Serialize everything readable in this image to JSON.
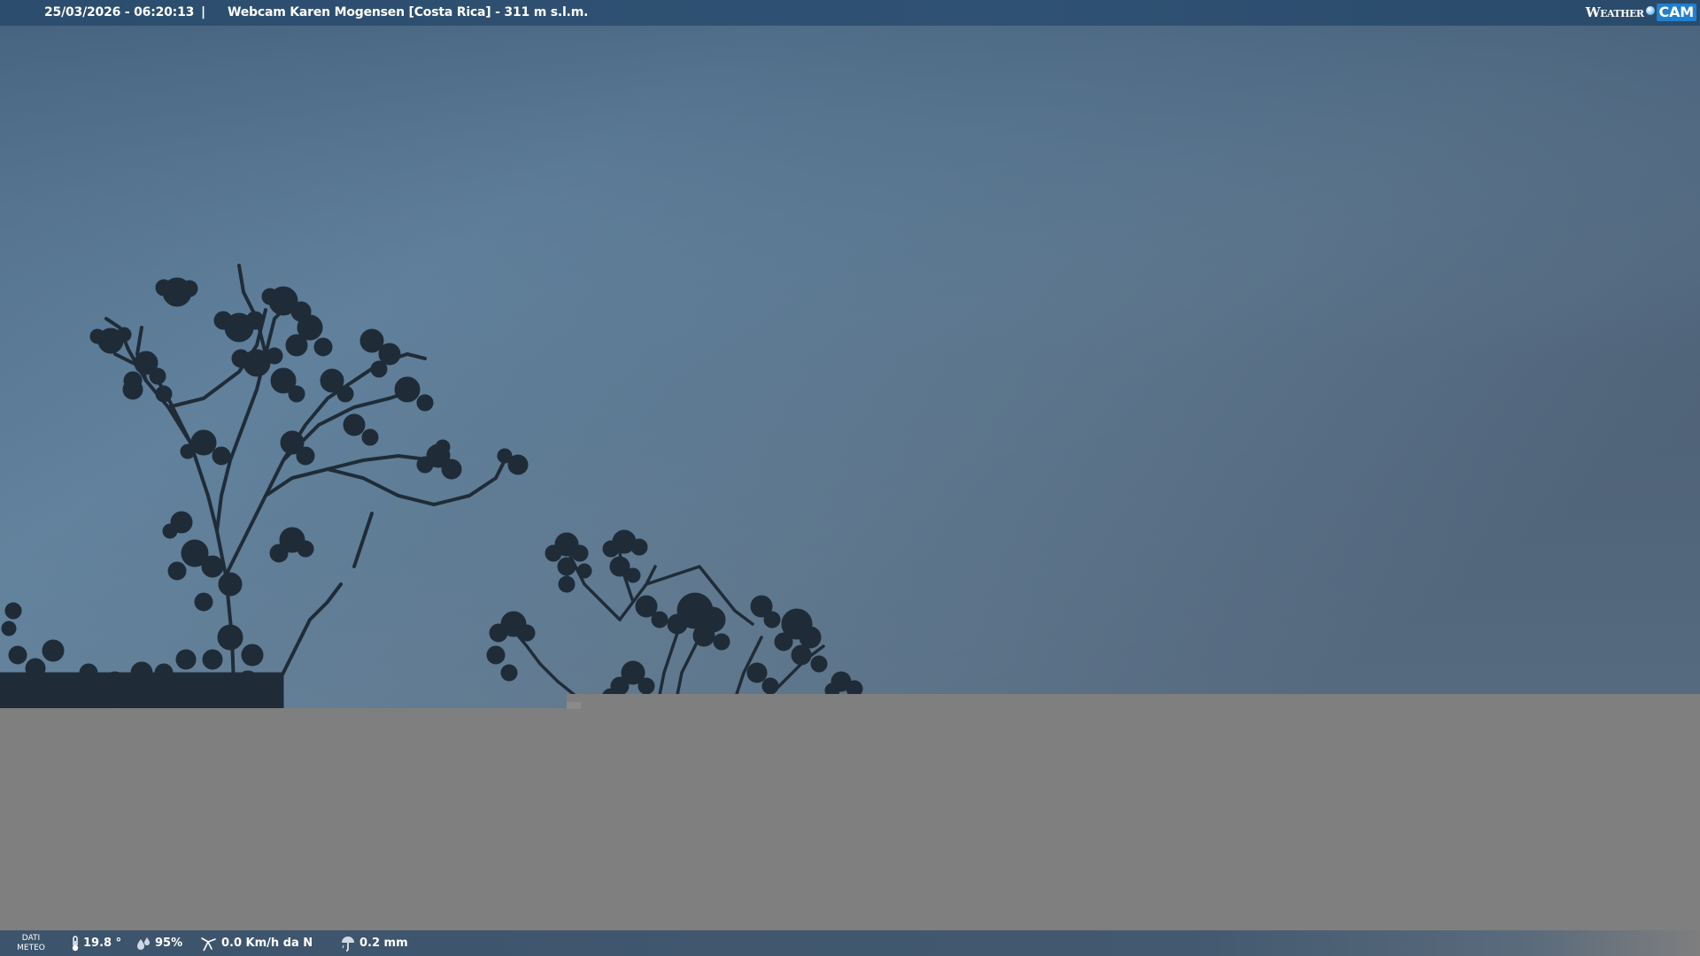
{
  "header": {
    "datetime": "25/03/2026 - 06:20:13",
    "separator": "|",
    "title": "Webcam Karen Mogensen [Costa Rica]  - 311 m s.l.m.",
    "logo": {
      "word1": "Weather",
      "word2": "CAM"
    }
  },
  "footer": {
    "label_line1": "DATI",
    "label_line2": "METEO",
    "temperature": "19.8 °",
    "humidity": "95%",
    "wind": "0.0 Km/h da N",
    "rain": "0.2 mm",
    "icons": [
      "thermometer-icon",
      "humidity-drops-icon",
      "wind-icon",
      "rain-icon"
    ]
  },
  "colors": {
    "sky_top_left": "#4f6c88",
    "sky_mid": "#62819b",
    "sky_right": "#4c6077",
    "ground_gray": "#7f7f7f",
    "bar_bg": "#2e4f70",
    "logo_accent": "#1f7fd0"
  }
}
